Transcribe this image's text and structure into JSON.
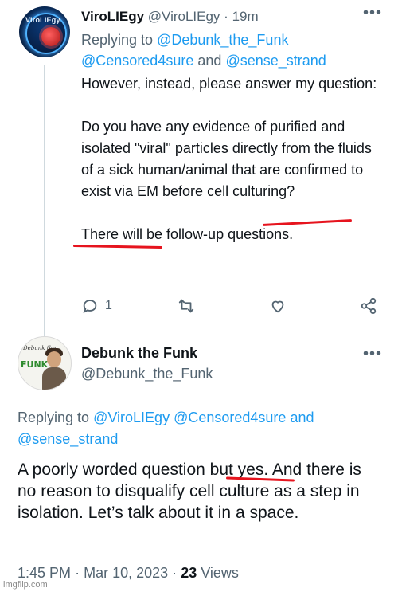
{
  "colors": {
    "text": "#0f1419",
    "muted": "#536471",
    "link": "#1d9bf0",
    "annotation_red": "#e6141e",
    "thread_line": "#cfd9de"
  },
  "tweet1": {
    "avatar_logo_text": "ViroLIEgy",
    "display_name": "ViroLIEgy",
    "handle": "@ViroLIEgy",
    "separator": "·",
    "time": "19m",
    "more_icon": "more-horizontal-icon",
    "replying_prefix": "Replying to",
    "replying_mentions": [
      "@Debunk_the_Funk",
      "@Censored4sure",
      "@sense_strand"
    ],
    "replying_and": "and",
    "body": {
      "para1": "However, instead, please answer my question:",
      "para2": "Do you have any evidence of purified and isolated \"viral\" particles directly from the fluids of a sick human/animal that are confirmed to exist via EM before cell culturing?",
      "para3": "There will be follow-up questions."
    },
    "actions": {
      "reply_icon": "reply-icon",
      "reply_count": "1",
      "retweet_icon": "retweet-icon",
      "like_icon": "heart-icon",
      "share_icon": "share-icon"
    }
  },
  "tweet2": {
    "avatar_text": "Debunk the",
    "avatar_funk": "FUNK",
    "display_name": "Debunk the Funk",
    "handle": "@Debunk_the_Funk",
    "more_icon": "more-horizontal-icon",
    "replying_prefix": "Replying to",
    "replying_mentions": [
      "@ViroLIEgy",
      "@Censored4sure",
      "@sense_strand"
    ],
    "replying_and": "and",
    "body": "A poorly worded question but yes. And there is no reason to disqualify cell culture as a step in isolation. Let’s talk about it in a space.",
    "time": "1:45 PM",
    "date": "Mar 10, 2023",
    "separator": "·",
    "views_count": "23",
    "views_label": "Views"
  },
  "watermark": "imgflip.com"
}
